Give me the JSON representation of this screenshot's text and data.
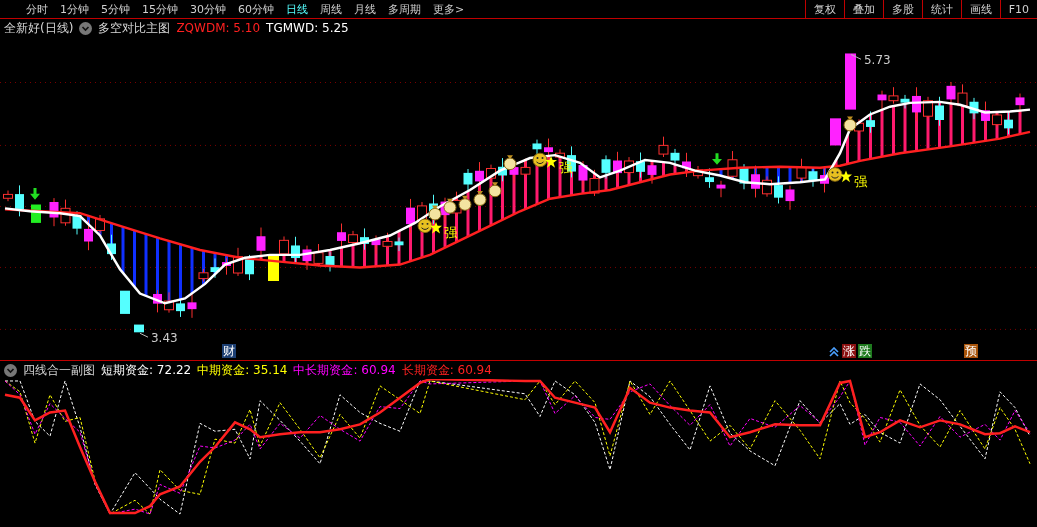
{
  "toolbar": {
    "tabs": [
      {
        "label": "分时",
        "selected": false
      },
      {
        "label": "1分钟",
        "selected": false
      },
      {
        "label": "5分钟",
        "selected": false
      },
      {
        "label": "15分钟",
        "selected": false
      },
      {
        "label": "30分钟",
        "selected": false
      },
      {
        "label": "60分钟",
        "selected": false
      },
      {
        "label": "日线",
        "selected": true
      },
      {
        "label": "周线",
        "selected": false
      },
      {
        "label": "月线",
        "selected": false
      },
      {
        "label": "多周期",
        "selected": false
      },
      {
        "label": "更多>",
        "selected": false
      }
    ],
    "buttons": [
      "复权",
      "叠加",
      "多股",
      "统计",
      "画线",
      "F10"
    ]
  },
  "main_chart": {
    "title": "全新好(日线)",
    "indicator": "多空对比主图",
    "readings": [
      {
        "text": "ZQWDM: 5.10",
        "color": "#ff2020"
      },
      {
        "text": "TGMWD: 5.25",
        "color": "#ffffff"
      }
    ],
    "high_label": "5.73",
    "low_label": "3.43",
    "signals": [
      {
        "text": "强"
      },
      {
        "text": "强"
      },
      {
        "text": "强"
      }
    ]
  },
  "event_markers": [
    {
      "text": "财",
      "color": "#1c3f73"
    },
    {
      "text": "涨",
      "color": "#8a1010"
    },
    {
      "text": "跌",
      "color": "#1e7a1e"
    },
    {
      "text": "预",
      "color": "#a8540a"
    }
  ],
  "sub_chart": {
    "title": "四线合一副图",
    "readings": [
      {
        "text": "短期资金: 72.22",
        "color": "#ffffff"
      },
      {
        "text": "中期资金: 35.14",
        "color": "#ffff00"
      },
      {
        "text": "中长期资金: 60.94",
        "color": "#ff00ff"
      },
      {
        "text": "长期资金: 60.94",
        "color": "#ff2020"
      }
    ]
  }
}
